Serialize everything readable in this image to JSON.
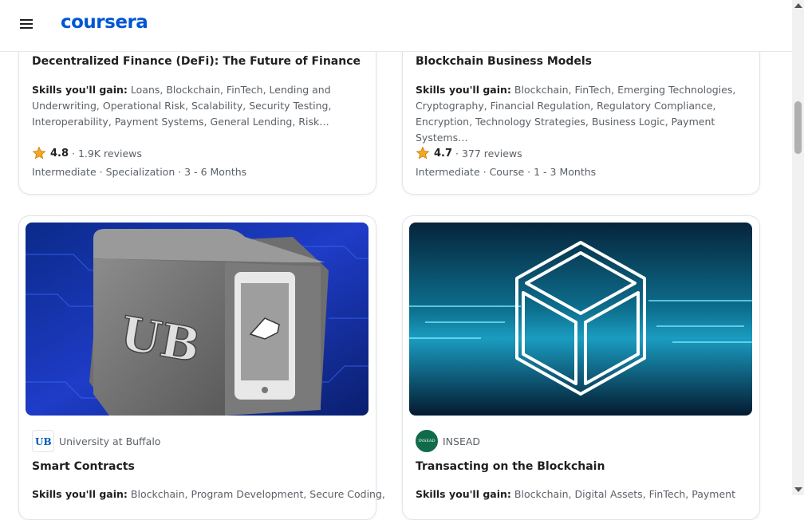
{
  "brand": {
    "name": "coursera",
    "color": "#0056d2"
  },
  "icons": {
    "menu": "hamburger-menu-icon",
    "star": "star-icon"
  },
  "cards": [
    {
      "title": "Decentralized Finance (DeFi): The Future of Finance",
      "skills_label": "Skills you'll gain:",
      "skills": " Loans, Blockchain, FinTech, Lending and Underwriting, Operational Risk, Scalability, Security Testing, Interoperability, Payment Systems, General Lending, Risk…",
      "rating": "4.8",
      "reviews": "· 1.9K reviews",
      "meta": "Intermediate · Specialization · 3 - 6 Months"
    },
    {
      "title": "Blockchain Business Models",
      "skills_label": "Skills you'll gain:",
      "skills": " Blockchain, FinTech, Emerging Technologies, Cryptography, Financial Regulation, Regulatory Compliance, Encryption, Technology Strategies, Business Logic, Payment Systems…",
      "rating": "4.7",
      "reviews": "· 377 reviews",
      "meta": "Intermediate · Course · 1 - 3 Months"
    },
    {
      "partner": "University at Buffalo",
      "title": "Smart Contracts",
      "skills_label": "Skills you'll gain:",
      "skills": " Blockchain, Program Development, Secure Coding,"
    },
    {
      "partner": "INSEAD",
      "title": "Transacting on the Blockchain",
      "skills_label": "Skills you'll gain:",
      "skills": " Blockchain, Digital Assets, FinTech, Payment"
    }
  ]
}
